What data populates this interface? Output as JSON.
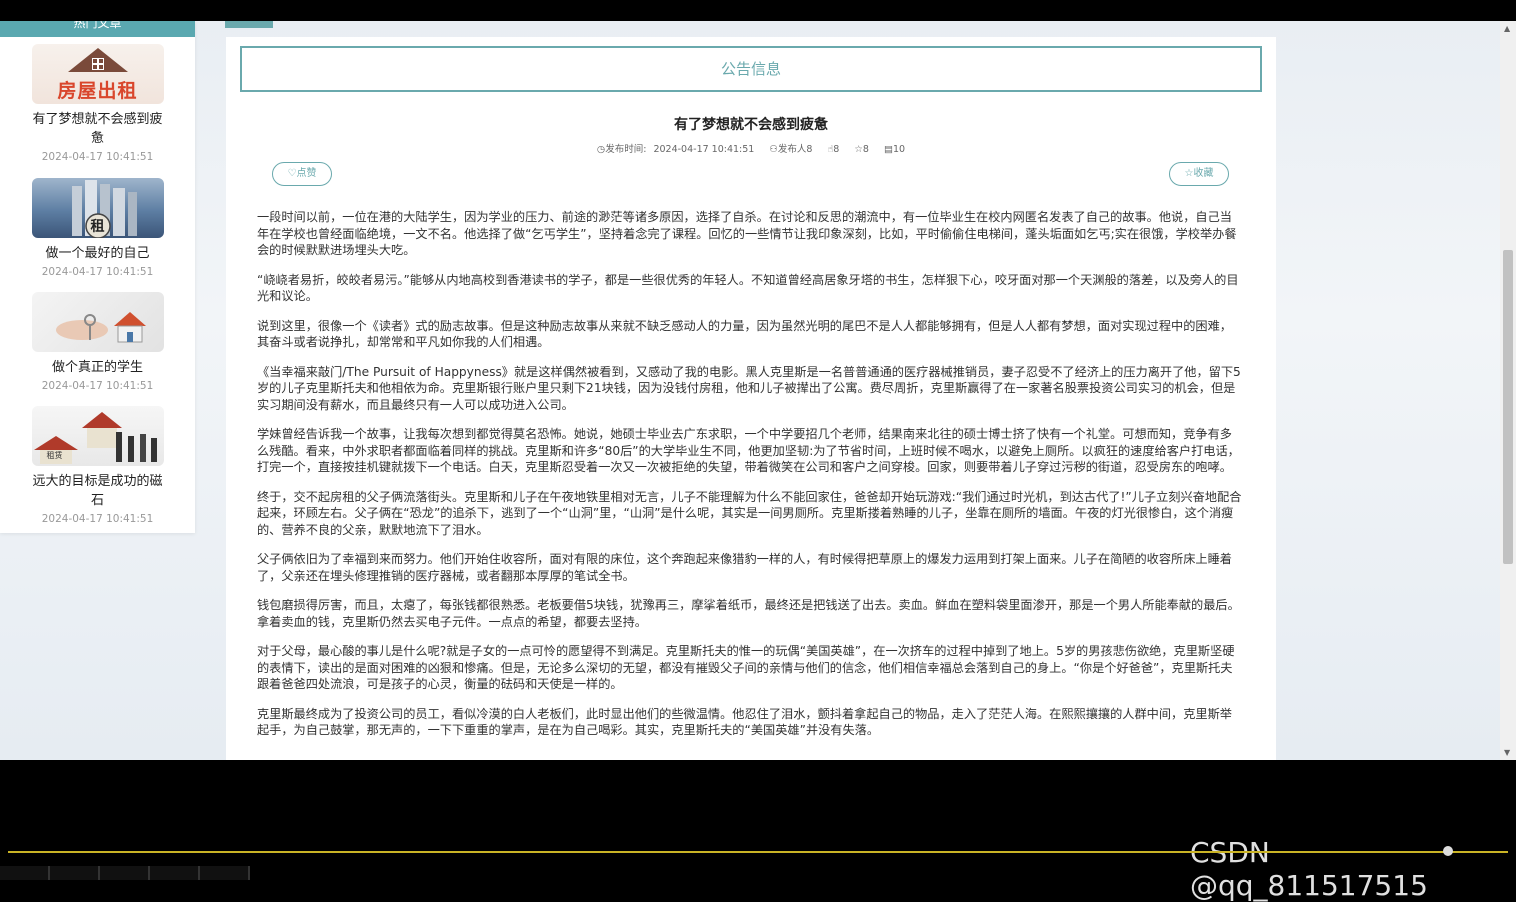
{
  "sidebar": {
    "head_label": "热门文章",
    "items": [
      {
        "title": "有了梦想就不会感到疲惫",
        "date": "2024-04-17 10:41:51",
        "thumb_text": "房屋出租"
      },
      {
        "title": "做一个最好的自己",
        "date": "2024-04-17 10:41:51",
        "thumb_text": "租"
      },
      {
        "title": "做个真正的学生",
        "date": "2024-04-17 10:41:51",
        "thumb_text": ""
      },
      {
        "title": "远大的目标是成功的磁石",
        "date": "2024-04-17 10:41:51",
        "thumb_text": "租赁"
      }
    ]
  },
  "main": {
    "section_title": "公告信息",
    "article": {
      "title": "有了梦想就不会感到疲惫",
      "meta": {
        "publish_label": "发布时间:",
        "publish_time": "2024-04-17 10:41:51",
        "author": "发布人8",
        "likes": "8",
        "favorites": "8",
        "views": "10"
      },
      "like_button": "点赞",
      "fav_button": "收藏",
      "paragraphs": [
        "一段时间以前，一位在港的大陆学生，因为学业的压力、前途的渺茫等诸多原因，选择了自杀。在讨论和反思的潮流中，有一位毕业生在校内网匿名发表了自己的故事。他说，自己当年在学校也曾经面临绝境，一文不名。他选择了做“乞丐学生”，坚持着念完了课程。回忆的一些情节让我印象深刻，比如，平时偷偷住电梯间，蓬头垢面如乞丐;实在很饿，学校举办餐会的时候默默进场埋头大吃。",
        "“峣峣者易折，皎皎者易污。”能够从内地高校到香港读书的学子，都是一些很优秀的年轻人。不知道曾经高居象牙塔的书生，怎样狠下心，咬牙面对那一个天渊般的落差，以及旁人的目光和议论。",
        "说到这里，很像一个《读者》式的励志故事。但是这种励志故事从来就不缺乏感动人的力量，因为虽然光明的尾巴不是人人都能够拥有，但是人人都有梦想，面对实现过程中的困难，其奋斗或者说挣扎，却常常和平凡如你我的人们相遇。",
        "《当幸福来敲门/The Pursuit of Happyness》就是这样偶然被看到，又感动了我的电影。黑人克里斯是一名普普通通的医疗器械推销员，妻子忍受不了经济上的压力离开了他，留下5岁的儿子克里斯托夫和他相依为命。克里斯银行账户里只剩下21块钱，因为没钱付房租，他和儿子被撵出了公寓。费尽周折，克里斯赢得了在一家著名股票投资公司实习的机会，但是实习期间没有薪水，而且最终只有一人可以成功进入公司。",
        "学妹曾经告诉我一个故事，让我每次想到都觉得莫名恐怖。她说，她硕士毕业去广东求职，一个中学要招几个老师，结果南来北往的硕士博士挤了快有一个礼堂。可想而知，竞争有多么残酷。看来，中外求职者都面临着同样的挑战。克里斯和许多“80后”的大学毕业生不同，他更加坚韧:为了节省时间，上班时候不喝水，以避免上厕所。以疯狂的速度给客户打电话，打完一个，直接按挂机键就拨下一个电话。白天，克里斯忍受着一次又一次被拒绝的失望，带着微笑在公司和客户之间穿梭。回家，则要带着儿子穿过污秽的街道，忍受房东的咆哮。",
        "终于，交不起房租的父子俩流落街头。克里斯和儿子在午夜地铁里相对无言，儿子不能理解为什么不能回家住，爸爸却开始玩游戏:“我们通过时光机，到达古代了!”儿子立刻兴奋地配合起来，环顾左右。父子俩在“恐龙”的追杀下，逃到了一个“山洞”里，“山洞”是什么呢，其实是一间男厕所。克里斯搂着熟睡的儿子，坐靠在厕所的墙面。午夜的灯光很惨白，这个消瘦的、营养不良的父亲，默默地流下了泪水。",
        "父子俩依旧为了幸福到来而努力。他们开始住收容所，面对有限的床位，这个奔跑起来像猎豹一样的人，有时候得把草原上的爆发力运用到打架上面来。儿子在简陋的收容所床上睡着了，父亲还在埋头修理推销的医疗器械，或者翻那本厚厚的笔试全书。",
        "钱包磨损得厉害，而且，太瘪了，每张钱都很熟悉。老板要借5块钱，犹豫再三，摩挲着纸币，最终还是把钱送了出去。卖血。鲜血在塑料袋里面渗开，那是一个男人所能奉献的最后。拿着卖血的钱，克里斯仍然去买电子元件。一点点的希望，都要去坚持。",
        "对于父母，最心酸的事儿是什么呢?就是子女的一点可怜的愿望得不到满足。克里斯托夫的惟一的玩偶“美国英雄”，在一次挤车的过程中掉到了地上。5岁的男孩悲伤欲绝，克里斯坚硬的表情下，读出的是面对困难的凶狠和惨痛。但是，无论多么深切的无望，都没有摧毁父子间的亲情与他们的信念，他们相信幸福总会落到自己的身上。“你是个好爸爸”，克里斯托夫跟着爸爸四处流浪，可是孩子的心灵，衡量的砝码和天使是一样的。",
        "克里斯最终成为了投资公司的员工，看似冷漠的白人老板们，此时显出他们的些微温情。他忍住了泪水，颤抖着拿起自己的物品，走入了茫茫人海。在熙熙攘攘的人群中间，克里斯举起手，为自己鼓掌，那无声的，一下下重重的掌声，是在为自己喝彩。其实，克里斯托夫的“美国英雄”并没有失落。"
      ]
    }
  },
  "watermark": "CSDN @qq_811517515",
  "colors": {
    "accent": "#6aa9ad",
    "progress": "#c9b325"
  },
  "playback": {
    "progress_fraction": 0.96
  }
}
